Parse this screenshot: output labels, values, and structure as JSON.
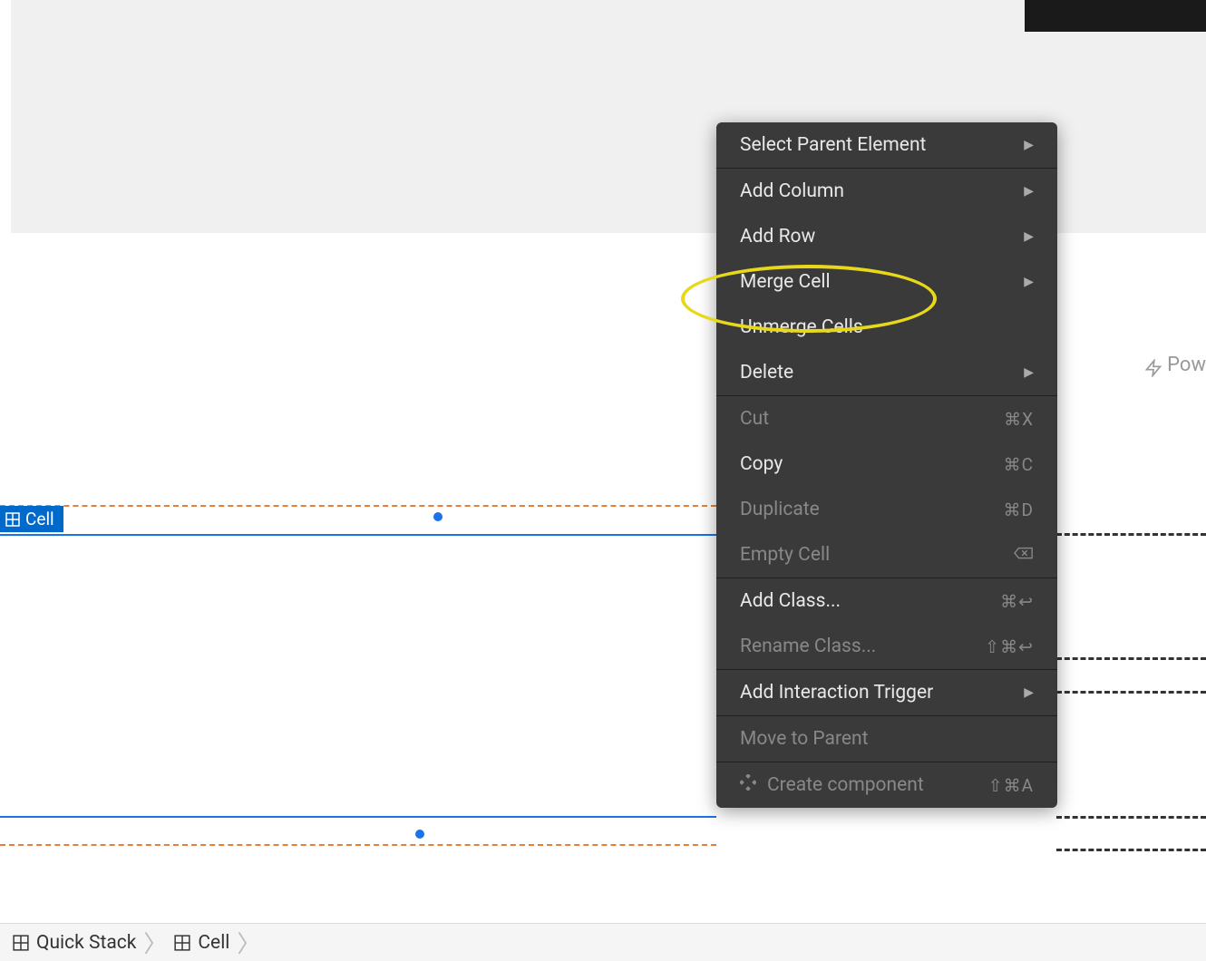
{
  "canvas": {
    "selected_element_label": "Cell"
  },
  "breadcrumb": {
    "items": [
      {
        "label": "Quick Stack"
      },
      {
        "label": "Cell"
      }
    ]
  },
  "side_text": "Pow",
  "context_menu": {
    "groups": [
      [
        {
          "label": "Select Parent Element",
          "has_submenu": true,
          "enabled": true
        }
      ],
      [
        {
          "label": "Add Column",
          "has_submenu": true,
          "enabled": true
        },
        {
          "label": "Add Row",
          "has_submenu": true,
          "enabled": true
        },
        {
          "label": "Merge Cell",
          "has_submenu": true,
          "enabled": true,
          "highlighted": true
        },
        {
          "label": "Unmerge Cells",
          "has_submenu": false,
          "enabled": true
        },
        {
          "label": "Delete",
          "has_submenu": true,
          "enabled": true
        }
      ],
      [
        {
          "label": "Cut",
          "shortcut": "⌘X",
          "enabled": false
        },
        {
          "label": "Copy",
          "shortcut": "⌘C",
          "enabled": true
        },
        {
          "label": "Duplicate",
          "shortcut": "⌘D",
          "enabled": false
        },
        {
          "label": "Empty Cell",
          "icon": "backspace",
          "enabled": false
        }
      ],
      [
        {
          "label": "Add Class...",
          "shortcut": "⌘↩",
          "enabled": true
        },
        {
          "label": "Rename Class...",
          "shortcut": "⇧⌘↩",
          "enabled": false
        }
      ],
      [
        {
          "label": "Add Interaction Trigger",
          "has_submenu": true,
          "enabled": true
        }
      ],
      [
        {
          "label": "Move to Parent",
          "enabled": false
        }
      ],
      [
        {
          "label": "Create component",
          "shortcut": "⇧⌘A",
          "icon": "component",
          "enabled": false
        }
      ]
    ]
  }
}
